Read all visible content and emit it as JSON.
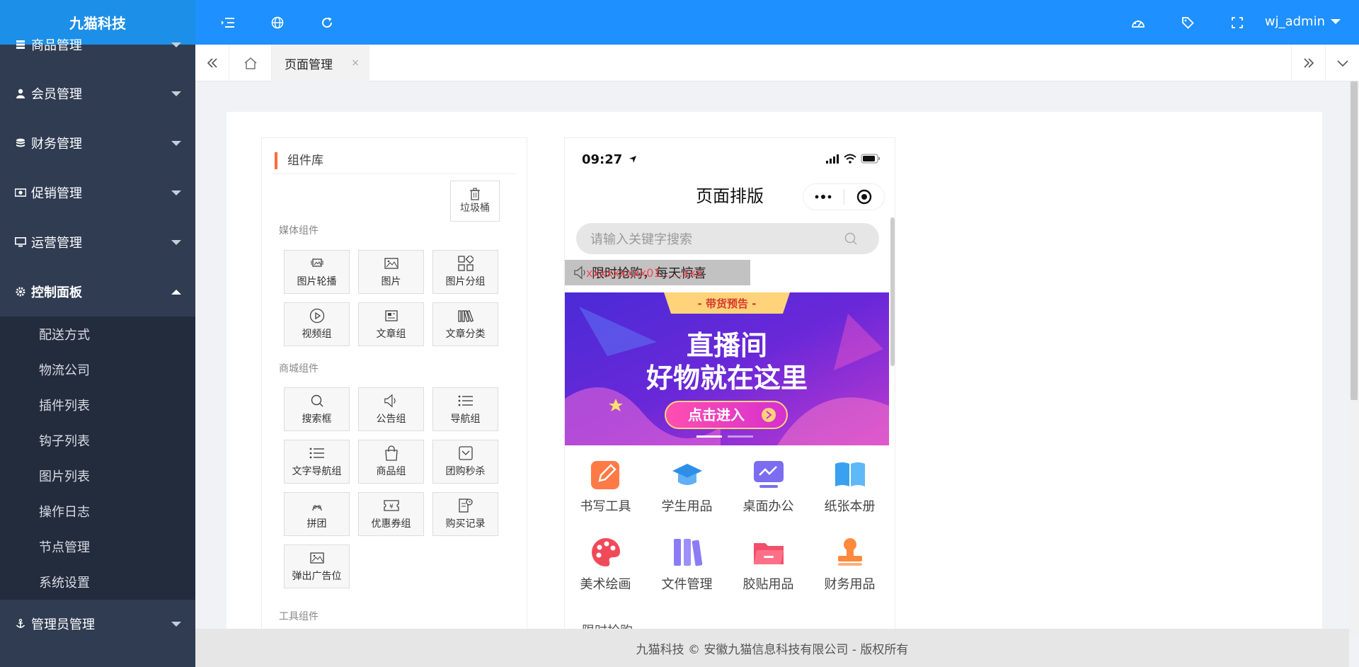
{
  "app": {
    "title": "九猫科技"
  },
  "sidebar": {
    "items": [
      {
        "label": "商品管理",
        "icon": "database-icon"
      },
      {
        "label": "会员管理",
        "icon": "user-icon"
      },
      {
        "label": "财务管理",
        "icon": "coins-icon"
      },
      {
        "label": "促销管理",
        "icon": "money-icon"
      },
      {
        "label": "运营管理",
        "icon": "monitor-icon"
      },
      {
        "label": "控制面板",
        "icon": "gear-icon"
      }
    ],
    "submenu": [
      "配送方式",
      "物流公司",
      "插件列表",
      "钩子列表",
      "图片列表",
      "操作日志",
      "节点管理",
      "系统设置"
    ],
    "bottom_item": {
      "label": "管理员管理",
      "icon": "anchor-icon"
    }
  },
  "header": {
    "user": "wj_admin"
  },
  "tabs": {
    "active_label": "页面管理",
    "close": "×"
  },
  "library": {
    "title": "组件库",
    "trash_label": "垃圾桶",
    "groups": [
      {
        "label": "媒体组件",
        "items": [
          "图片轮播",
          "图片",
          "图片分组",
          "视频组",
          "文章组",
          "文章分类"
        ]
      },
      {
        "label": "商城组件",
        "items": [
          "搜索框",
          "公告组",
          "导航组",
          "文字导航组",
          "商品组",
          "团购秒杀",
          "拼团",
          "优惠券组",
          "购买记录",
          "弹出广告位"
        ]
      },
      {
        "label": "工具组件",
        "items": []
      }
    ]
  },
  "phone": {
    "time": "09:27",
    "title": "页面排版",
    "search_placeholder": "请输入关键字搜索",
    "notice_text": "限时抢购，每天惊喜",
    "notice_overlay": "xxxxxxxxx01......xxx",
    "banner": {
      "tag": "- 带货预告 -",
      "line1": "直播间",
      "line2": "好物就在这里",
      "button": "点击进入"
    },
    "categories": [
      {
        "label": "书写工具",
        "color": "#ff7a45"
      },
      {
        "label": "学生用品",
        "color": "#2f8fe8"
      },
      {
        "label": "桌面办公",
        "color": "#7b6cf0"
      },
      {
        "label": "纸张本册",
        "color": "#3aa0f0"
      },
      {
        "label": "美术绘画",
        "color": "#f04a5a"
      },
      {
        "label": "文件管理",
        "color": "#8b7cf5"
      },
      {
        "label": "胶贴用品",
        "color": "#f0506a"
      },
      {
        "label": "财务用品",
        "color": "#ff8a3d"
      }
    ],
    "peek_text": "限时抢购"
  },
  "footer": {
    "text": "九猫科技 © 安徽九猫信息科技有限公司 - 版权所有"
  },
  "colors": {
    "header": "#1e90ff",
    "sidebar": "#2f3c52",
    "accent": "#ff6a3d"
  }
}
